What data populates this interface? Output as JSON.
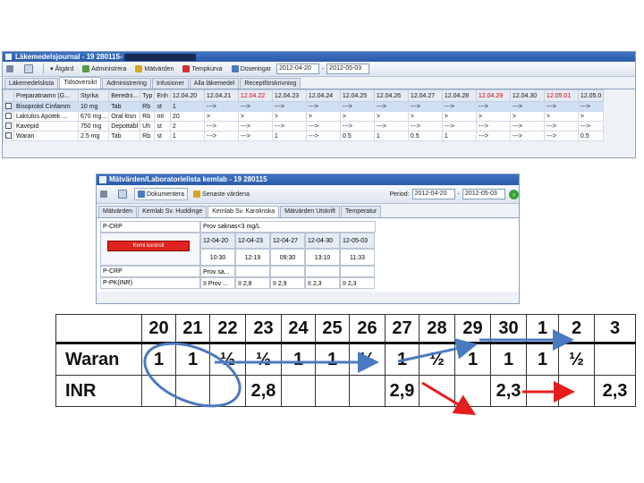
{
  "window1": {
    "title": "Läkemedelsjournal - 19 280115-",
    "toolbar": {
      "atgard": "Åtgärd",
      "administrera": "Administrera",
      "matvarden": "Mätvärden",
      "tempkurva": "Tempkurva",
      "doseringar": "Doseringar",
      "date_from": "2012-04-20",
      "date_to": "2012-05-03"
    },
    "tabs": [
      "Läkemedelslista",
      "Tidsöversikt",
      "Administrering",
      "Infusioner",
      "Alla läkemedel",
      "Receptförskrivning"
    ],
    "active_tab": 1,
    "columns": [
      "",
      "Preparatnamn (G...",
      "Styrka",
      "Beredni...",
      "Typ",
      "Enh",
      "12.04.20",
      "12.04.21",
      "12.04.22",
      "12.04.23",
      "12.04.24",
      "12.04.25",
      "12.04.26",
      "12.04.27",
      "12.04.28",
      "12.04.29",
      "12.04.30",
      "12.05.01",
      "12.05.0"
    ],
    "red_columns": [
      8,
      15,
      17
    ],
    "rows": [
      [
        "",
        "Bisoprolol Cinfamm",
        "10 mg",
        "Tab",
        "Rb",
        "st",
        "1",
        "--->",
        "--->",
        "--->",
        "--->",
        "--->",
        "--->",
        "--->",
        "--->",
        "--->",
        "--->",
        "--->",
        "--->"
      ],
      [
        "",
        "Laktulos Apotek ...",
        "670 mg...",
        "Oral lösn",
        "Rb",
        "ml",
        "20",
        ">",
        ">",
        ">",
        ">",
        ">",
        ">",
        ">",
        ">",
        ">",
        ">",
        ">",
        ">"
      ],
      [
        "",
        "Kavepid",
        "750 mg",
        "Depottabl",
        "Uh",
        "st",
        "2",
        "--->",
        "--->",
        "--->",
        "--->",
        "--->",
        "--->",
        "--->",
        "--->",
        "--->",
        "--->",
        "--->",
        "--->"
      ],
      [
        "",
        "Waran",
        "2.5 mg",
        "Tab",
        "Rb",
        "st",
        "1",
        "--->",
        "--->",
        "1",
        "--->",
        "0.5",
        "1",
        "0.5",
        "1",
        "--->",
        "--->",
        "--->",
        "0.5"
      ]
    ]
  },
  "window2": {
    "title": "Mätvärden/Laboratorielista kemlab - 19 280115",
    "toolbar": {
      "dokumentera": "Dokumentera",
      "senaste_varden": "Senaste värdena",
      "period_label": "Period:",
      "date_from": "2012-04-20",
      "date_to": "2012-05-03"
    },
    "tabs": [
      "Mätvärden",
      "Kemlab Sv. Huddinge",
      "Kemlab Sv. Karolinska",
      "Mätvärden Utskrift",
      "Temperatur"
    ],
    "active_tab": 2,
    "left_label": "P-CRP",
    "red_button": "Kemi kontroll",
    "left_rows": [
      "P-CRP",
      "P-PK(INR)"
    ],
    "prov_saknas": "Prov saknas<3 mg/L",
    "dates": [
      "12-04-20",
      "12-04-23",
      "12-04-27",
      "12-04-30",
      "12-05-03"
    ],
    "times": [
      "10:30",
      "12:19",
      "09:30",
      "13:10",
      "11:33"
    ],
    "row_crp": [
      "Prov sa...",
      "",
      "",
      "",
      ""
    ],
    "row_inr": [
      "II Prov ...",
      "II 2,8",
      "II 2,9",
      "II 2,3",
      "II 2,3"
    ]
  },
  "summary": {
    "days": [
      "20",
      "21",
      "22",
      "23",
      "24",
      "25",
      "26",
      "27",
      "28",
      "29",
      "30",
      "1",
      "2",
      "3"
    ],
    "waran_label": "Waran",
    "waran": [
      "1",
      "1",
      "½",
      "½",
      "1",
      "1",
      "½",
      "1",
      "½",
      "1",
      "1",
      "1",
      "½",
      ""
    ],
    "inr_label": "INR",
    "inr": [
      "",
      "",
      "",
      "2,8",
      "",
      "",
      "",
      "2,9",
      "",
      "",
      "2,3",
      "",
      "",
      "2,3"
    ]
  },
  "colors": {
    "accent_blue": "#4a7abf",
    "arrow_red": "#e41e1e",
    "title_blue": "#2b5aa8",
    "red_date": "#d00000"
  }
}
